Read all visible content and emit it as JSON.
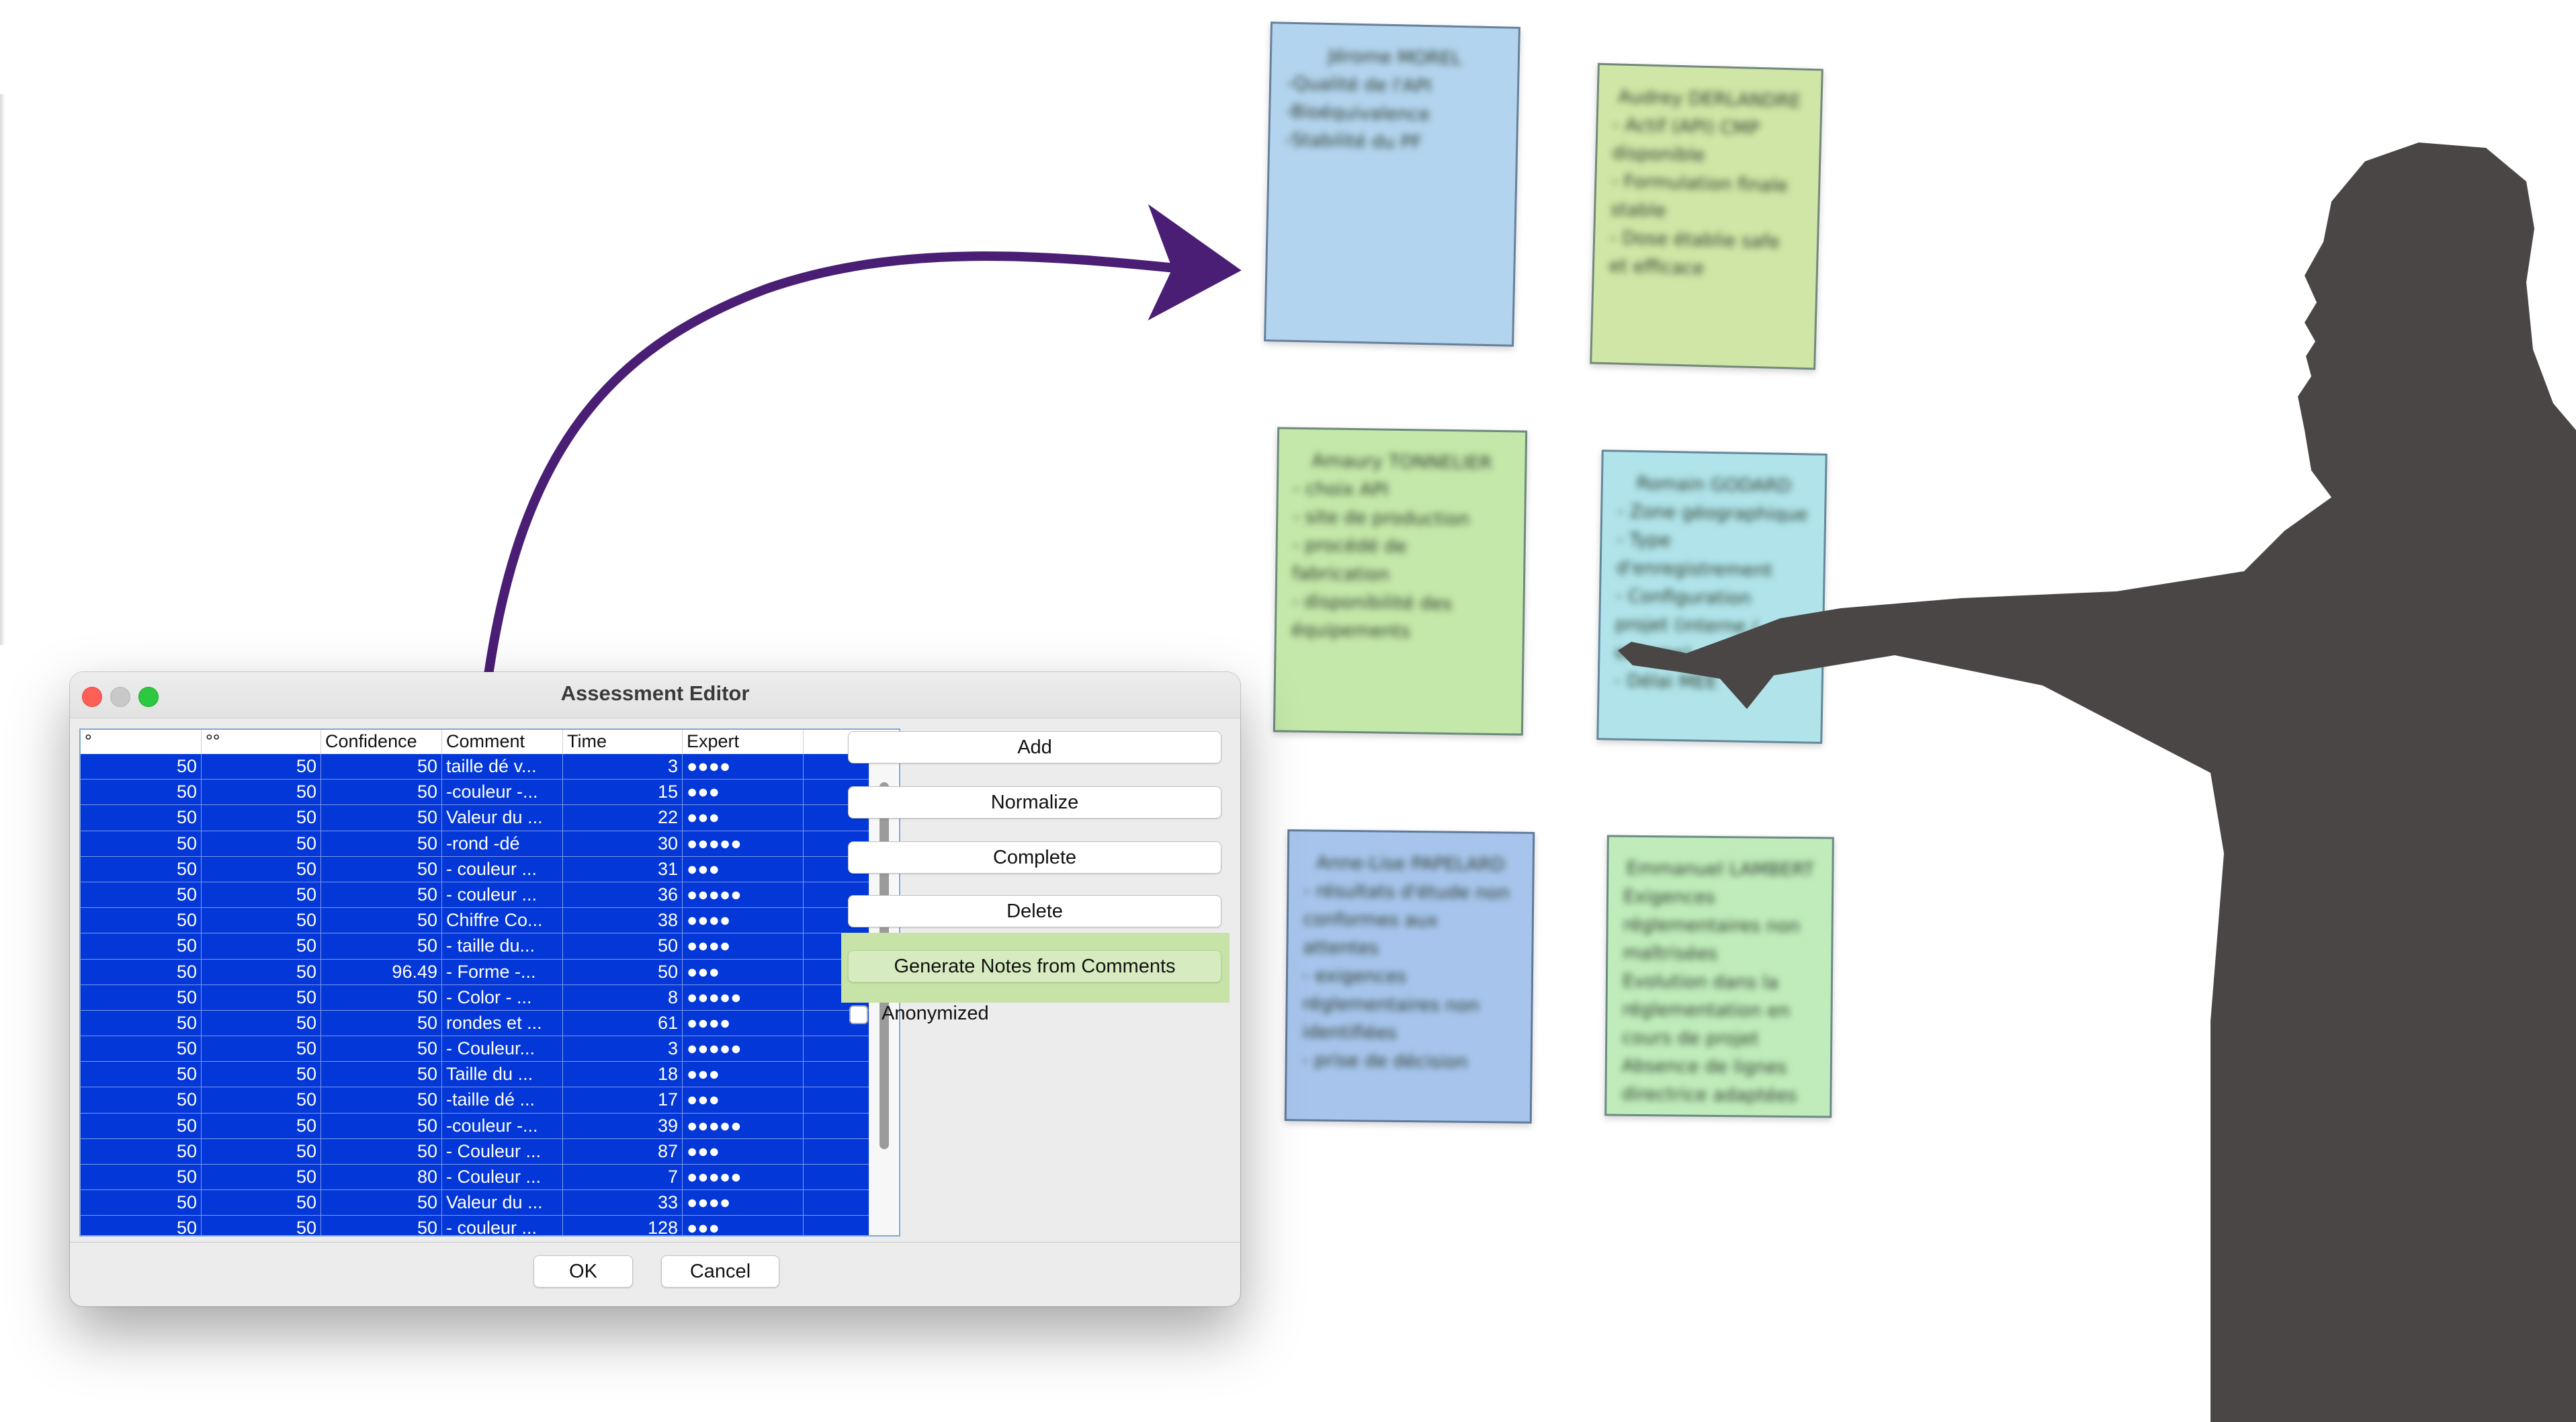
{
  "dialog": {
    "title": "Assessment Editor",
    "columns": [
      "°",
      "°°",
      "Confidence",
      "Comment",
      "Time",
      "Expert"
    ],
    "rows": [
      [
        "50",
        "50",
        "50",
        "taille dé v...",
        "3",
        "●●●●"
      ],
      [
        "50",
        "50",
        "50",
        "-couleur -...",
        "15",
        "●●●"
      ],
      [
        "50",
        "50",
        "50",
        "Valeur du ...",
        "22",
        "●●●"
      ],
      [
        "50",
        "50",
        "50",
        "-rond -dé",
        "30",
        "●●●●●"
      ],
      [
        "50",
        "50",
        "50",
        "- couleur ...",
        "31",
        "●●●"
      ],
      [
        "50",
        "50",
        "50",
        "- couleur ...",
        "36",
        "●●●●●"
      ],
      [
        "50",
        "50",
        "50",
        "Chiffre Co...",
        "38",
        "●●●●"
      ],
      [
        "50",
        "50",
        "50",
        "- taille du...",
        "50",
        "●●●●"
      ],
      [
        "50",
        "50",
        "96.49",
        "- Forme -...",
        "50",
        "●●●"
      ],
      [
        "50",
        "50",
        "50",
        "- Color - ...",
        "8",
        "●●●●●"
      ],
      [
        "50",
        "50",
        "50",
        "rondes et ...",
        "61",
        "●●●●"
      ],
      [
        "50",
        "50",
        "50",
        "- Couleur...",
        "3",
        "●●●●●"
      ],
      [
        "50",
        "50",
        "50",
        "Taille du ...",
        "18",
        "●●●"
      ],
      [
        "50",
        "50",
        "50",
        "-taille dé ...",
        "17",
        "●●●"
      ],
      [
        "50",
        "50",
        "50",
        "-couleur -...",
        "39",
        "●●●●●"
      ],
      [
        "50",
        "50",
        "50",
        "- Couleur ...",
        "87",
        "●●●"
      ],
      [
        "50",
        "50",
        "80",
        "- Couleur ...",
        "7",
        "●●●●●"
      ],
      [
        "50",
        "50",
        "50",
        "Valeur du ...",
        "33",
        "●●●●"
      ],
      [
        "50",
        "50",
        "50",
        "- couleur ...",
        "128",
        "●●●"
      ]
    ],
    "buttons": {
      "add": "Add",
      "normalize": "Normalize",
      "complete": "Complete",
      "delete": "Delete",
      "generate": "Generate Notes from Comments"
    },
    "anonymized_label": "Anonymized",
    "anonymized_checked": false,
    "ok": "OK",
    "cancel": "Cancel",
    "selection_color": "#0337d8",
    "highlight_color": "#c7e3a7"
  },
  "notes": [
    {
      "color": "#b3d4ee",
      "lines": [
        "Jérome MOREL",
        "-Qualité de l'API",
        "-Bioéquivalence",
        "-Stabilité du PF"
      ]
    },
    {
      "color": "#cfe6a6",
      "lines": [
        "Audrey DERLANDRE",
        "- Actif (API) CMP disponible",
        "- Formulation finale stable",
        "- Dose établie safe et efficace"
      ]
    },
    {
      "color": "#c3e8a9",
      "lines": [
        "Amaury TONNELIER",
        "- choix API",
        "- site de production",
        "- procédé de fabrication",
        "- disponibilité des équipements"
      ]
    },
    {
      "color": "#b0e4ea",
      "lines": [
        "Romain GODARD",
        "- Zone géographique",
        "- Type d'enregistrement",
        "- Configuration projet (interne / externe)",
        "- Délai MEE"
      ]
    },
    {
      "color": "#a7c5ec",
      "lines": [
        "Anne-Lise PAPELARD",
        "- résultats d'étude non conformes aux attentes",
        "- exigences réglementaires non identifiées",
        "- prise de décision"
      ]
    },
    {
      "color": "#c0ecbb",
      "lines": [
        "Emmanuel LAMBERT",
        "Exigences réglementaires non maîtrisées",
        "Evolution dans la réglementation en cours de projet",
        "Absence de lignes directrice adaptées"
      ]
    }
  ],
  "arrow_color": "#4a1e74",
  "silhouette_color": "#4a4646"
}
